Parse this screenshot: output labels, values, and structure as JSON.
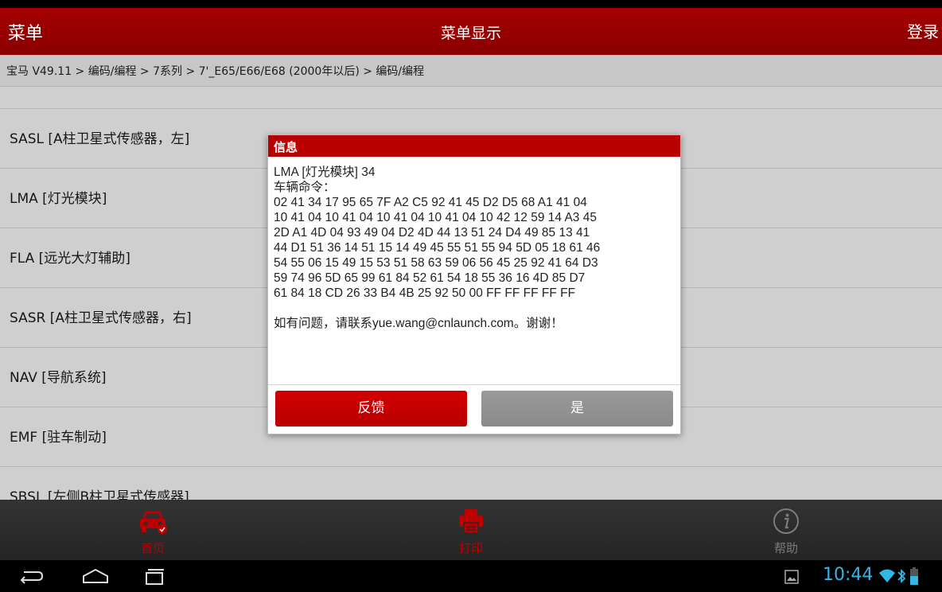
{
  "header": {
    "menu_label": "菜单",
    "title": "菜单显示",
    "login_label": "登录"
  },
  "breadcrumb": "宝马 V49.11 > 编码/编程 > 7系列 > 7'_E65/E66/E68 (2000年以后) > 编码/编程",
  "list": {
    "items": [
      "SASL [A柱卫星式传感器，左]",
      "LMA [灯光模块]",
      "FLA [远光大灯辅助]",
      "SASR [A柱卫星式传感器，右]",
      "NAV [导航系统]",
      "EMF [驻车制动]",
      "SBSL [左侧B柱卫星式传感器]"
    ]
  },
  "dialog": {
    "title": "信息",
    "module": "LMA [灯光模块] 34",
    "command_label": "车辆命令：",
    "hex_lines": [
      "02 41 34 17 95 65 7F A2 C5 92 41 45 D2 D5 68 A1 41 04",
      "10 41 04 10 41 04 10 41 04 10 41 04 10 42 12 59 14 A3 45",
      "2D A1 4D 04 93 49 04 D2 4D 44 13 51 24 D4 49 85 13 41",
      "44 D1 51 36 14 51 15 14 49 45 55 51 55 94 5D 05 18 61 46",
      "54 55 06 15 49 15 53 51 58 63 59 06 56 45 25 92 41 64 D3",
      "59 74 96 5D 65 99 61 84 52 61 54 18 55 36 16 4D 85 D7",
      "61 84 18 CD 26 33 B4 4B 25 92 50 00 FF FF FF FF FF"
    ],
    "contact": "如有问题，请联系yue.wang@cnlaunch.com。谢谢！",
    "feedback_button": "反馈",
    "yes_button": "是"
  },
  "tabbar": {
    "home": "首页",
    "print": "打印",
    "help": "帮助"
  },
  "status": {
    "time": "10:44"
  },
  "colors": {
    "brand_red": "#b80000",
    "header_red": "#a50000",
    "clock_blue": "#33b5e5",
    "disabled_gray": "#8a8a8a"
  },
  "icons": {
    "home": "car-icon",
    "print": "printer-icon",
    "help": "info-icon",
    "back": "back-icon",
    "home_nav": "home-nav-icon",
    "recents": "recents-icon"
  }
}
